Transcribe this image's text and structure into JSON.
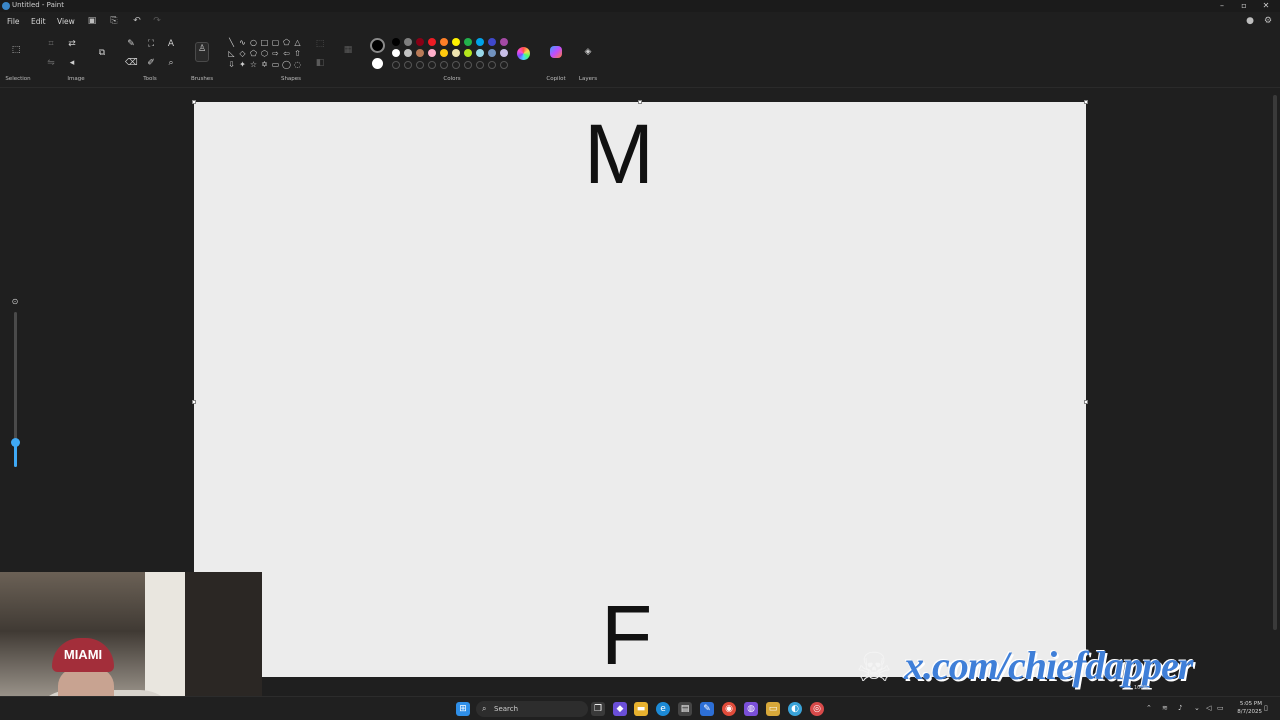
{
  "window": {
    "title": "Untitled - Paint",
    "controls": [
      "–",
      "▫",
      "✕"
    ]
  },
  "menu": {
    "items": [
      "File",
      "Edit",
      "View"
    ]
  },
  "ribbon": {
    "groups": {
      "selection": "Selection",
      "image": "Image",
      "tools": "Tools",
      "brushes": "Brushes",
      "shapes": "Shapes",
      "colors": "Colors",
      "copilot": "Copilot",
      "layers": "Layers"
    },
    "palette_row1": [
      "#000000",
      "#7f7f7f",
      "#880015",
      "#ed1c24",
      "#ff7f27",
      "#fff200",
      "#22b14c",
      "#00a2e8",
      "#3f48cc",
      "#a349a4"
    ],
    "palette_row2": [
      "#ffffff",
      "#c3c3c3",
      "#b97a57",
      "#ffaec9",
      "#ffc90e",
      "#efe4b0",
      "#b5e61d",
      "#99d9ea",
      "#7092be",
      "#c8bfe7"
    ],
    "primary_color": "#000000",
    "secondary_color": "#ffffff"
  },
  "canvas": {
    "letter_top": "M",
    "letter_bottom": "F"
  },
  "zoom_slider": {
    "level": 0.17
  },
  "webcam": {
    "cap_text": "MIAMI"
  },
  "watermark": {
    "handle": "x.com/chiefdapper"
  },
  "taskbar": {
    "search_label": "Search",
    "clock_time": "5:05 PM",
    "clock_date": "8/7/2025",
    "tray_battery": "100%"
  }
}
